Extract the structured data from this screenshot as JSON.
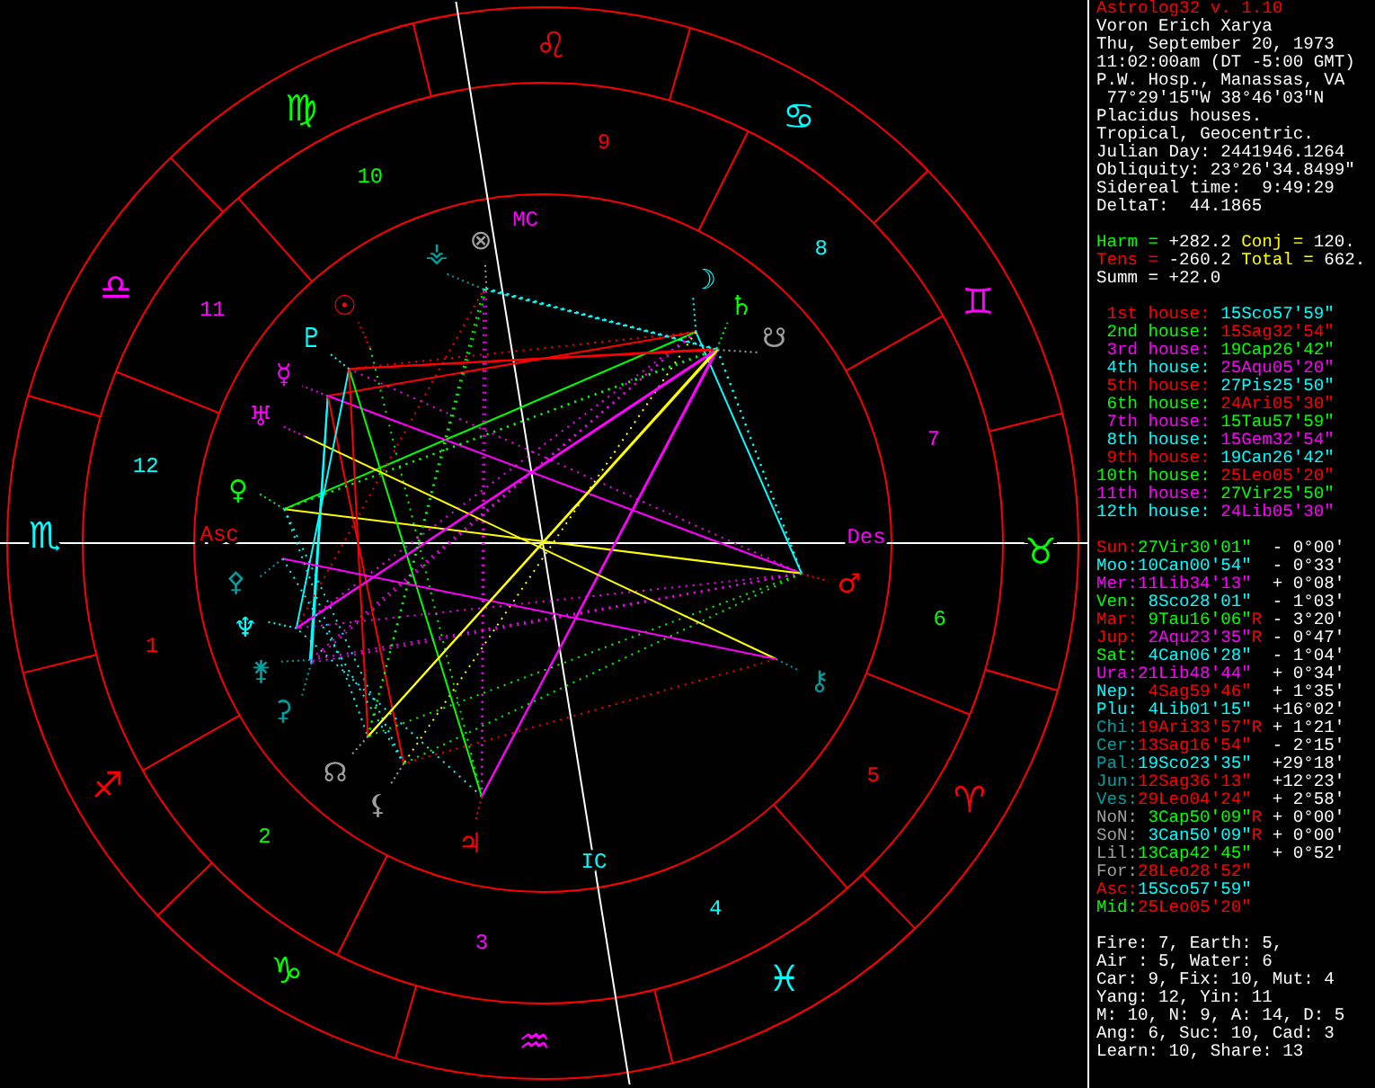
{
  "app_title": "Astrolog32 v. 1.10",
  "chart_info": [
    "Voron Erich Xarya",
    "Thu, September 20, 1973",
    "11:02:00am (DT -5:00 GMT)",
    "P.W. Hosp., Manassas, VA",
    " 77°29'15\"W 38°46'03\"N",
    "Placidus houses.",
    "Tropical, Geocentric.",
    "Julian Day: 2441946.1264",
    "Obliquity: 23°26'34.8499\"",
    "Sidereal time:  9:49:29",
    "DeltaT:  44.1865"
  ],
  "harmony": [
    {
      "pairs": [
        {
          "label": "Harm =",
          "value": "+282.2",
          "color": "#00ff00"
        },
        {
          "label": "Conj =",
          "value": "120.",
          "color": "#ffff00"
        }
      ]
    },
    {
      "pairs": [
        {
          "label": "Tens =",
          "value": "-260.2",
          "color": "#ff0000"
        },
        {
          "label": "Total =",
          "value": "662.",
          "color": "#ffff00"
        }
      ]
    },
    {
      "pairs": [
        {
          "label": "Summ =",
          "value": "+22.0",
          "color": "#ffffff"
        }
      ]
    }
  ],
  "houses": [
    {
      "number": "1",
      "label": "1st house:",
      "cusp": {
        "text": "15Sco57'59\"",
        "color": "#00ffff"
      },
      "color": "#ff0000"
    },
    {
      "number": "2",
      "label": "2nd house:",
      "cusp": {
        "text": "15Sag32'54\"",
        "color": "#ff0000"
      },
      "color": "#00ff00"
    },
    {
      "number": "3",
      "label": "3rd house:",
      "cusp": {
        "text": "19Cap26'42\"",
        "color": "#00ff00"
      },
      "color": "#ff00ff"
    },
    {
      "number": "4",
      "label": "4th house:",
      "cusp": {
        "text": "25Aqu05'20\"",
        "color": "#ff00ff"
      },
      "color": "#00ffff"
    },
    {
      "number": "5",
      "label": "5th house:",
      "cusp": {
        "text": "27Pis25'50\"",
        "color": "#00ffff"
      },
      "color": "#ff0000"
    },
    {
      "number": "6",
      "label": "6th house:",
      "cusp": {
        "text": "24Ari05'30\"",
        "color": "#ff0000"
      },
      "color": "#00ff00"
    },
    {
      "number": "7",
      "label": "7th house:",
      "cusp": {
        "text": "15Tau57'59\"",
        "color": "#00ff00"
      },
      "color": "#ff00ff"
    },
    {
      "number": "8",
      "label": "8th house:",
      "cusp": {
        "text": "15Gem32'54\"",
        "color": "#ff00ff"
      },
      "color": "#00ffff"
    },
    {
      "number": "9",
      "label": "9th house:",
      "cusp": {
        "text": "19Can26'42\"",
        "color": "#00ffff"
      },
      "color": "#ff0000"
    },
    {
      "number": "10",
      "label": "10th house:",
      "cusp": {
        "text": "25Leo05'20\"",
        "color": "#ff0000"
      },
      "color": "#00ff00"
    },
    {
      "number": "11",
      "label": "11th house:",
      "cusp": {
        "text": "27Vir25'50\"",
        "color": "#00ff00"
      },
      "color": "#ff00ff"
    },
    {
      "number": "12",
      "label": "12th house:",
      "cusp": {
        "text": "24Lib05'30\"",
        "color": "#ff00ff"
      },
      "color": "#00ffff"
    }
  ],
  "planets": [
    {
      "name": "Sun:",
      "glyph": "☉",
      "position": {
        "text": "27Vir30'01\"",
        "color": "#00ff00"
      },
      "motion": "- 0°00'",
      "color": "#ff0000"
    },
    {
      "name": "Moo:",
      "glyph": "☽",
      "position": {
        "text": "10Can00'54\"",
        "color": "#00ffff"
      },
      "motion": "- 0°33'",
      "color": "#00ffff"
    },
    {
      "name": "Mer:",
      "glyph": "☿",
      "position": {
        "text": "11Lib34'13\"",
        "color": "#ff00ff"
      },
      "motion": "+ 0°08'",
      "color": "#ff00ff"
    },
    {
      "name": "Ven:",
      "glyph": "♀",
      "position": {
        "text": "8Sco28'01\"",
        "color": "#00ffff"
      },
      "motion": "- 1°03'",
      "color": "#00ff00"
    },
    {
      "name": "Mar:",
      "glyph": "♂",
      "position": {
        "text": "9Tau16'06\"",
        "color": "#00ff00"
      },
      "flag": "R",
      "motion": "- 3°20'",
      "color": "#ff0000"
    },
    {
      "name": "Jup:",
      "glyph": "♃",
      "position": {
        "text": "2Aqu23'35\"",
        "color": "#ff00ff"
      },
      "flag": "R",
      "motion": "- 0°47'",
      "color": "#ff0000"
    },
    {
      "name": "Sat:",
      "glyph": "♄",
      "position": {
        "text": "4Can06'28\"",
        "color": "#00ffff"
      },
      "motion": "- 1°04'",
      "color": "#00ff00"
    },
    {
      "name": "Ura:",
      "glyph": "♅",
      "position": {
        "text": "21Lib48'44\"",
        "color": "#ff00ff"
      },
      "motion": "+ 0°34'",
      "color": "#ff00ff"
    },
    {
      "name": "Nep:",
      "glyph": "♆",
      "position": {
        "text": "4Sag59'46\"",
        "color": "#ff0000"
      },
      "motion": "+ 1°35'",
      "color": "#00ffff"
    },
    {
      "name": "Plu:",
      "glyph": "♇",
      "position": {
        "text": "4Lib01'15\"",
        "color": "#00ffff"
      },
      "motion": "+16°02'",
      "color": "#00ffff"
    },
    {
      "name": "Chi:",
      "glyph": "⚷",
      "position": {
        "text": "19Ari33'57\"",
        "color": "#ff0000"
      },
      "flag": "R",
      "motion": "+ 1°21'",
      "color": "#00a0a0"
    },
    {
      "name": "Cer:",
      "glyph": "⚳",
      "position": {
        "text": "13Sag16'54\"",
        "color": "#ff0000"
      },
      "motion": "- 2°15'",
      "color": "#00a0a0"
    },
    {
      "name": "Pal:",
      "glyph": "⚴",
      "position": {
        "text": "19Sco23'35\"",
        "color": "#00ffff"
      },
      "motion": "+29°18'",
      "color": "#00a0a0"
    },
    {
      "name": "Jun:",
      "glyph": "⚵",
      "position": {
        "text": "12Sag36'13\"",
        "color": "#ff0000"
      },
      "motion": "+12°23'",
      "color": "#00a0a0"
    },
    {
      "name": "Ves:",
      "glyph": "⚶",
      "position": {
        "text": "29Leo04'24\"",
        "color": "#ff0000"
      },
      "motion": "+ 2°58'",
      "color": "#00a0a0"
    },
    {
      "name": "NoN:",
      "glyph": "☊",
      "position": {
        "text": "3Cap50'09\"",
        "color": "#00ff00"
      },
      "flag": "R",
      "motion": "+ 0°00'",
      "color": "#a0a0a0"
    },
    {
      "name": "SoN:",
      "glyph": "☋",
      "position": {
        "text": "3Can50'09\"",
        "color": "#00ffff"
      },
      "flag": "R",
      "motion": "+ 0°00'",
      "color": "#a0a0a0"
    },
    {
      "name": "Lil:",
      "glyph": "⚸",
      "position": {
        "text": "13Cap42'45\"",
        "color": "#00ff00"
      },
      "motion": "+ 0°52'",
      "color": "#a0a0a0"
    },
    {
      "name": "For:",
      "glyph": "⊗",
      "position": {
        "text": "28Leo28'52\"",
        "color": "#ff0000"
      },
      "color": "#a0a0a0"
    },
    {
      "name": "Asc:",
      "position": {
        "text": "15Sco57'59\"",
        "color": "#00ffff"
      },
      "color": "#ff0000"
    },
    {
      "name": "Mid:",
      "position": {
        "text": "25Leo05'20\"",
        "color": "#ff0000"
      },
      "color": "#00ff00"
    }
  ],
  "element_summary": [
    "Fire: 7, Earth: 5,",
    "Air : 5, Water: 6",
    "Car: 9, Fix: 10, Mut: 4",
    "Yang: 12, Yin: 11",
    "M: 10, N: 9, A: 14, D: 5",
    "Ang: 6, Suc: 10, Cad: 3",
    "Learn: 10, Share: 13"
  ],
  "chart": {
    "signs": [
      {
        "glyph": "♈",
        "color": "#ff0000"
      },
      {
        "glyph": "♉",
        "color": "#00ff00"
      },
      {
        "glyph": "♊",
        "color": "#ff00ff"
      },
      {
        "glyph": "♋",
        "color": "#00ffff"
      },
      {
        "glyph": "♌",
        "color": "#ff0000"
      },
      {
        "glyph": "♍",
        "color": "#00ff00"
      },
      {
        "glyph": "♎",
        "color": "#ff00ff"
      },
      {
        "glyph": "♏",
        "color": "#00ffff"
      },
      {
        "glyph": "♐",
        "color": "#ff0000"
      },
      {
        "glyph": "♑",
        "color": "#00ff00"
      },
      {
        "glyph": "♒",
        "color": "#ff00ff"
      },
      {
        "glyph": "♓",
        "color": "#00ffff"
      }
    ],
    "angle_labels": [
      {
        "label": "Asc",
        "color": "#ff0000"
      },
      {
        "label": "Des",
        "color": "#ff00ff"
      },
      {
        "label": "MC",
        "color": "#ff00ff"
      },
      {
        "label": "IC",
        "color": "#00ffff"
      }
    ]
  }
}
